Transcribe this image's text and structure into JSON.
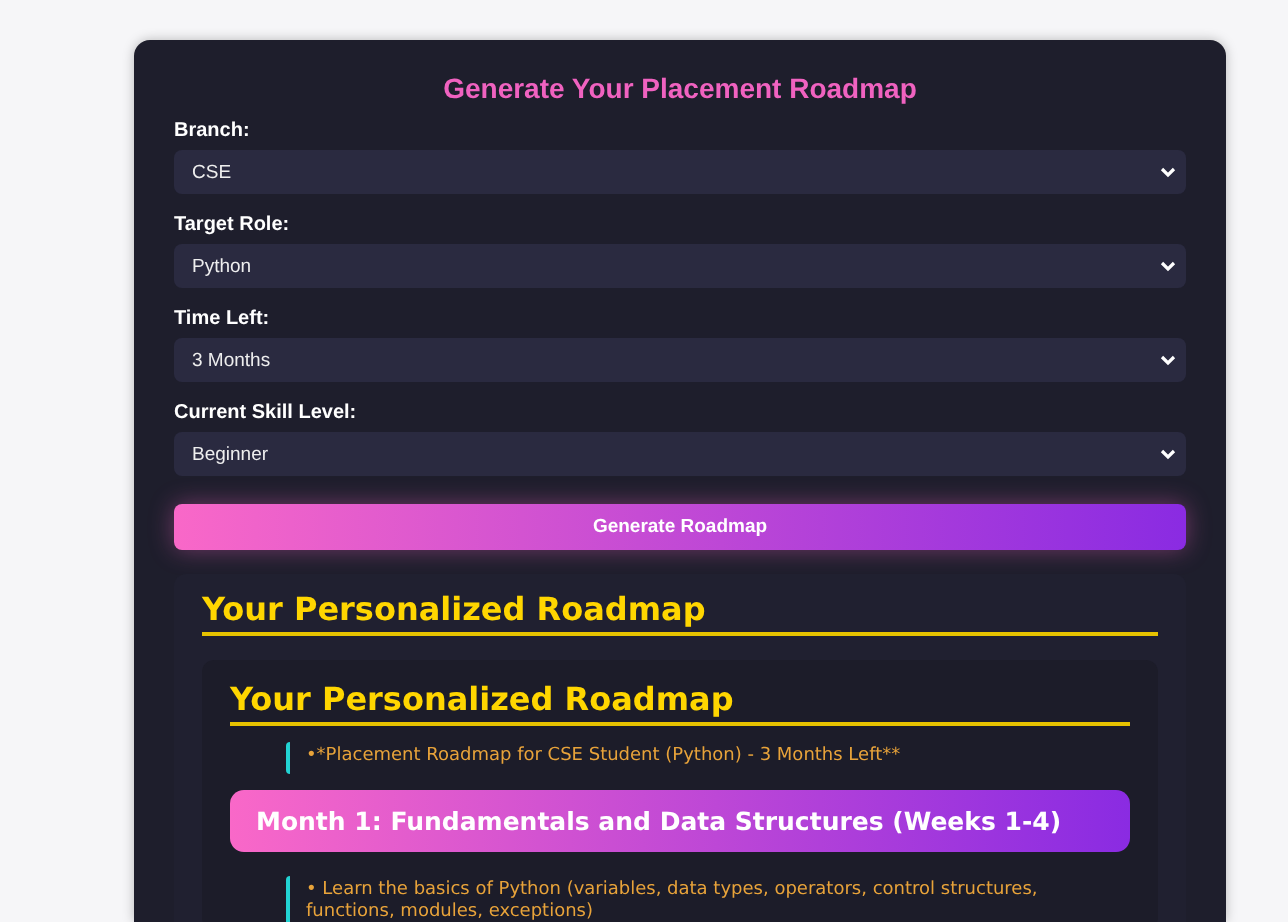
{
  "form": {
    "title": "Generate Your Placement Roadmap",
    "fields": [
      {
        "label": "Branch:",
        "value": "CSE"
      },
      {
        "label": "Target Role:",
        "value": "Python"
      },
      {
        "label": "Time Left:",
        "value": "3 Months"
      },
      {
        "label": "Current Skill Level:",
        "value": "Beginner"
      }
    ],
    "submit": "Generate Roadmap"
  },
  "result": {
    "heading": "Your Personalized Roadmap",
    "inner_heading": "Your Personalized Roadmap",
    "blocks": [
      {
        "kind": "note",
        "text": "•*Placement Roadmap for CSE Student (Python) - 3 Months Left**"
      },
      {
        "kind": "month",
        "text": "Month 1: Fundamentals and Data Structures (Weeks 1-4)"
      },
      {
        "kind": "note",
        "text": "• Learn the basics of Python (variables, data types, operators, control structures, functions, modules, exceptions)"
      }
    ]
  }
}
